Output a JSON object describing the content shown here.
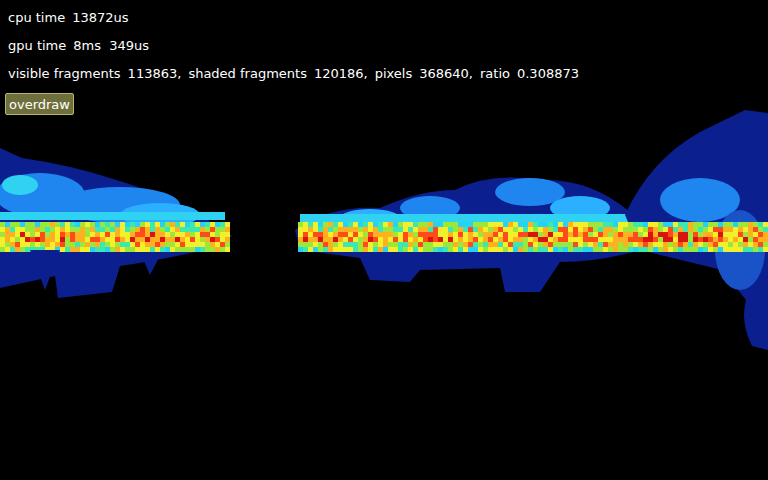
{
  "stats": [
    {
      "items": [
        {
          "label": "cpu time",
          "value": "13872us"
        }
      ]
    },
    {
      "items": [
        {
          "label": "gpu time",
          "value": "8ms  349us"
        }
      ]
    },
    {
      "items": [
        {
          "label": "visible fragments",
          "value": "113863,"
        },
        {
          "label": "shaded fragments",
          "value": "120186,"
        },
        {
          "label": "pixels",
          "value": "368640,"
        },
        {
          "label": "ratio",
          "value": "0.308873"
        }
      ]
    }
  ],
  "button": {
    "label": "overdraw",
    "active": true
  }
}
